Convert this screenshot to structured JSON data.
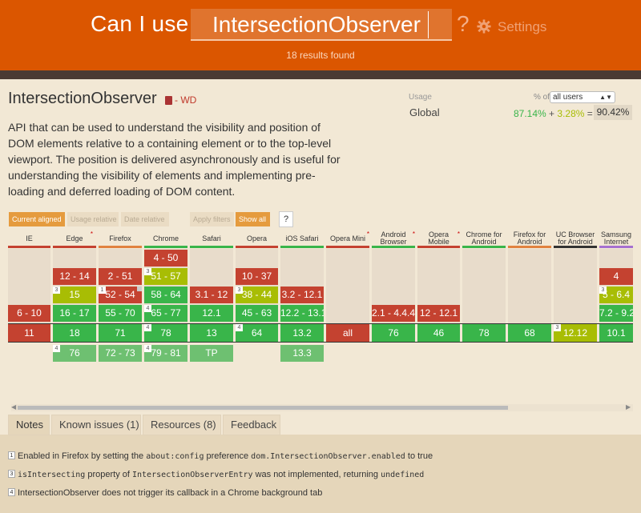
{
  "header": {
    "title": "Can I use",
    "search_value": "IntersectionObserver",
    "help": "?",
    "settings_label": "Settings",
    "results": "18 results found"
  },
  "feature": {
    "title": "IntersectionObserver",
    "status": "- WD",
    "description": "API that can be used to understand the visibility and position of DOM elements relative to a containing element or to the top-level viewport. The position is delivered asynchronously and is useful for understanding the visibility of elements and implementing pre-loading and deferred loading of DOM content."
  },
  "usage": {
    "label": "Usage",
    "pct_of": "% of",
    "selected": "all users",
    "region": "Global",
    "full": "87.14%",
    "plus": "+",
    "partial": "3.28%",
    "equals": "=",
    "total": "90.42%"
  },
  "filters": {
    "current_aligned": "Current aligned",
    "usage_relative": "Usage relative",
    "date_relative": "Date relative",
    "apply_filters": "Apply filters",
    "show_all": "Show all",
    "help": "?"
  },
  "browsers": [
    {
      "name": "IE",
      "color": "#c44230"
    },
    {
      "name": "Edge",
      "color": "#c44230"
    },
    {
      "name": "Firefox",
      "color": "#e18240"
    },
    {
      "name": "Chrome",
      "color": "#39b54a"
    },
    {
      "name": "Safari",
      "color": "#39b54a"
    },
    {
      "name": "Opera",
      "color": "#c44230"
    },
    {
      "name": "iOS Safari",
      "color": "#39b54a"
    },
    {
      "name": "Opera Mini",
      "color": "#c44230"
    },
    {
      "name": "Android Browser",
      "color": "#39b54a"
    },
    {
      "name": "Opera Mobile",
      "color": "#c44230"
    },
    {
      "name": "Chrome for Android",
      "color": "#39b54a"
    },
    {
      "name": "Firefox for Android",
      "color": "#e18240"
    },
    {
      "name": "UC Browser for Android",
      "color": "#333333"
    },
    {
      "name": "Samsung Internet",
      "color": "#a670d0"
    }
  ],
  "cells": {
    "chrome_450": "4 - 50",
    "edge_1214": "12 - 14",
    "ff_251": "2 - 51",
    "chrome_5157": "51 - 57",
    "opera_1037": "10 - 37",
    "sam_4": "4",
    "edge_15": "15",
    "ff_5254": "52 - 54",
    "chrome_5864": "58 - 64",
    "safari_3112": "3.1 - 12",
    "opera_3844": "38 - 44",
    "ios_32121": "3.2 - 12.1",
    "sam_564": "5 - 6.4",
    "ie_610": "6 - 10",
    "edge_1617": "16 - 17",
    "ff_5570": "55 - 70",
    "chrome_6577": "65 - 77",
    "safari_121": "12.1",
    "opera_4563": "45 - 63",
    "ios_122131": "12.2 - 13.1",
    "and_21444": "2.1 - 4.4.4",
    "opm_12121": "12 - 12.1",
    "sam_7292": "7.2 - 9.2",
    "ie_11": "11",
    "edge_18": "18",
    "ff_71": "71",
    "chrome_78": "78",
    "safari_13": "13",
    "opera_64": "64",
    "ios_132": "13.2",
    "opmini_all": "all",
    "and_76": "76",
    "opm_46": "46",
    "cfa_78": "78",
    "ffa_68": "68",
    "uc_1212": "12.12",
    "sam_101": "10.1",
    "edge_76": "76",
    "ff_7273": "72 - 73",
    "chrome_7981": "79 - 81",
    "safari_tp": "TP",
    "ios_133": "13.3"
  },
  "tabs": [
    "Notes",
    "Known issues (1)",
    "Resources (8)",
    "Feedback"
  ],
  "notes": [
    {
      "num": "1",
      "pre": "Enabled in Firefox by setting the ",
      "code1": "about:config",
      "mid": " preference ",
      "code2": "dom.IntersectionObserver.enabled",
      "post": " to true"
    },
    {
      "num": "3",
      "code1": "isIntersecting",
      "mid": " property of ",
      "code2": "IntersectionObserverEntry",
      "post": " was not implemented, returning ",
      "code3": "undefined"
    },
    {
      "num": "4",
      "text": "IntersectionObserver does not trigger its callback in a Chrome background tab"
    }
  ]
}
